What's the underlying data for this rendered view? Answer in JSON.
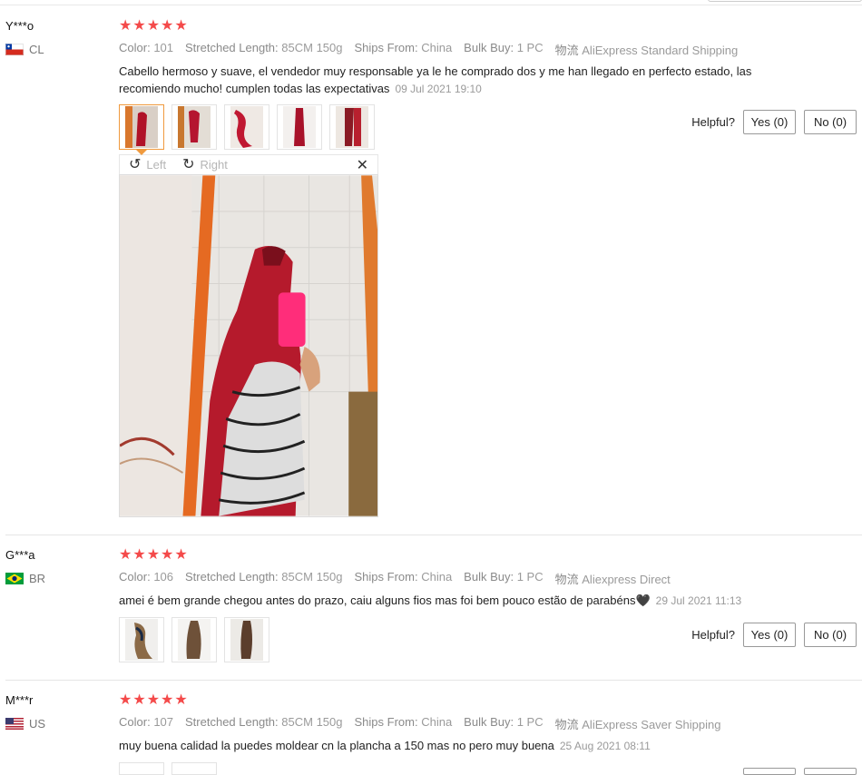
{
  "reviews": [
    {
      "user": "Y***o",
      "country": "CL",
      "rating": 5,
      "meta": [
        {
          "k": "Color:",
          "v": "101"
        },
        {
          "k": "Stretched Length:",
          "v": "85CM 150g"
        },
        {
          "k": "Ships From:",
          "v": "China"
        },
        {
          "k": "Bulk Buy:",
          "v": "1 PC"
        },
        {
          "k": "物流",
          "v": "AliExpress Standard Shipping"
        }
      ],
      "text": "Cabello hermoso y suave, el vendedor muy responsable ya le he comprado dos y me han llegado en perfecto estado, las recomiendo mucho! cumplen todas las expectativas",
      "date": "09 Jul 2021 19:10",
      "helpful_label": "Helpful?",
      "yes_label": "Yes (0)",
      "no_label": "No (0)"
    },
    {
      "user": "G***a",
      "country": "BR",
      "rating": 5,
      "meta": [
        {
          "k": "Color:",
          "v": "106"
        },
        {
          "k": "Stretched Length:",
          "v": "85CM 150g"
        },
        {
          "k": "Ships From:",
          "v": "China"
        },
        {
          "k": "Bulk Buy:",
          "v": "1 PC"
        },
        {
          "k": "物流",
          "v": "Aliexpress Direct"
        }
      ],
      "text": "amei é bem grande chegou antes do prazo, caiu alguns fios mas foi bem pouco estão de parabéns🖤",
      "date": "29 Jul 2021 11:13",
      "helpful_label": "Helpful?",
      "yes_label": "Yes (0)",
      "no_label": "No (0)"
    },
    {
      "user": "M***r",
      "country": "US",
      "rating": 5,
      "meta": [
        {
          "k": "Color:",
          "v": "107"
        },
        {
          "k": "Stretched Length:",
          "v": "85CM 150g"
        },
        {
          "k": "Ships From:",
          "v": "China"
        },
        {
          "k": "Bulk Buy:",
          "v": "1 PC"
        },
        {
          "k": "物流",
          "v": "AliExpress Saver Shipping"
        }
      ],
      "text": "muy buena calidad la puedes moldear cn la plancha a 150 mas no pero muy buena",
      "date": "25 Aug 2021 08:11"
    }
  ],
  "viewer": {
    "rotate_left_label": "Left",
    "rotate_right_label": "Right",
    "close_icon": "close-icon"
  },
  "colors": {
    "star": "#f44a4a",
    "active_thumb_border": "#f09a3e",
    "muted_text": "#9a9a9a"
  }
}
